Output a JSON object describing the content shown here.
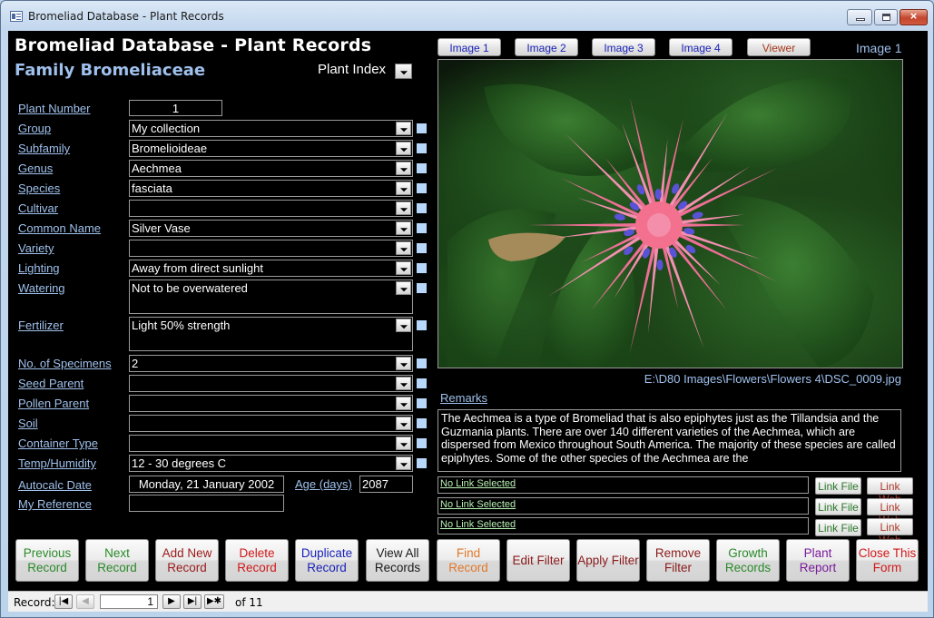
{
  "window": {
    "title": "Bromeliad  Database - Plant Records",
    "controls": {
      "minimize": "minimize",
      "maximize": "maximize",
      "close": "×"
    }
  },
  "header": {
    "title": "Bromeliad  Database - Plant Records",
    "family": "Family Bromeliaceae",
    "plant_index_label": "Plant Index"
  },
  "fields": {
    "plant_number": {
      "label": "Plant Number",
      "value": "1"
    },
    "group": {
      "label": "Group",
      "value": "My collection"
    },
    "subfamily": {
      "label": "Subfamily",
      "value": "Bromelioideae"
    },
    "genus": {
      "label": "Genus",
      "value": "Aechmea"
    },
    "species": {
      "label": "Species",
      "value": "fasciata"
    },
    "cultivar": {
      "label": "Cultivar",
      "value": ""
    },
    "common_name": {
      "label": "Common Name",
      "value": "Silver Vase"
    },
    "variety": {
      "label": "Variety",
      "value": ""
    },
    "lighting": {
      "label": "Lighting",
      "value": "Away from direct sunlight"
    },
    "watering": {
      "label": "Watering",
      "value": "Not to be overwatered"
    },
    "fertilizer": {
      "label": "Fertilizer",
      "value": "Light 50% strength"
    },
    "specimens": {
      "label": "No. of Specimens",
      "value": "2"
    },
    "seed_parent": {
      "label": "Seed Parent",
      "value": ""
    },
    "pollen_parent": {
      "label": "Pollen Parent",
      "value": ""
    },
    "soil": {
      "label": "Soil",
      "value": ""
    },
    "container_type": {
      "label": "Container Type",
      "value": ""
    },
    "temp_humidity": {
      "label": "Temp/Humidity",
      "value": "12 - 30 degrees C"
    },
    "autocalc_date": {
      "label": "Autocalc Date",
      "value": "Monday, 21 January 2002"
    },
    "age_days": {
      "label": "Age (days)",
      "value": "2087"
    },
    "my_reference": {
      "label": "My Reference",
      "value": ""
    }
  },
  "images": {
    "buttons": [
      "Image 1",
      "Image 2",
      "Image 3",
      "Image 4"
    ],
    "viewer": "Viewer",
    "current": "Image 1",
    "path": "E:\\D80 Images\\Flowers\\Flowers 4\\DSC_0009.jpg",
    "description": "Pink Aechmea fasciata bromeliad flower with blue florets among green leaves"
  },
  "remarks": {
    "label": "Remarks",
    "text": "The Aechmea is a type of Bromeliad that is also epiphytes just as the Tillandsia and the Guzmania plants. There are over 140 different varieties of the Aechmea, which are dispersed from Mexico throughout South America. The majority of these species are called epiphytes. Some of the other species of the Aechmea are the"
  },
  "links": [
    {
      "text": "No Link Selected",
      "file_btn": "Link File",
      "web_btn": "Link Web"
    },
    {
      "text": "No Link Selected",
      "file_btn": "Link File",
      "web_btn": "Link Web"
    },
    {
      "text": "No Link Selected",
      "file_btn": "Link File",
      "web_btn": "Link Web"
    }
  ],
  "commands": [
    {
      "label": "Previous Record",
      "color": "#2a8a2a"
    },
    {
      "label": "Next Record",
      "color": "#2a8a2a"
    },
    {
      "label": "Add New Record",
      "color": "#9a1a1a"
    },
    {
      "label": "Delete Record",
      "color": "#d01818"
    },
    {
      "label": "Duplicate Record",
      "color": "#1a22b8"
    },
    {
      "label": "View All Records",
      "color": "#1a1a1a"
    },
    {
      "label": "Find Record",
      "color": "#e0782a"
    },
    {
      "label": "Edit Filter",
      "color": "#8a1a1a"
    },
    {
      "label": "Apply Filter",
      "color": "#8a1a1a"
    },
    {
      "label": "Remove Filter",
      "color": "#8a1a1a"
    },
    {
      "label": "Growth Records",
      "color": "#2a8a2a"
    },
    {
      "label": "Plant Report",
      "color": "#7a1a9a"
    },
    {
      "label": "Close This Form",
      "color": "#d01818"
    }
  ],
  "navigation": {
    "record_label": "Record:",
    "current": "1",
    "of_label": "of",
    "total": "11",
    "first": "⏮",
    "prev": "◀",
    "next": "▶",
    "last": "⏭",
    "new": "▶✱"
  }
}
